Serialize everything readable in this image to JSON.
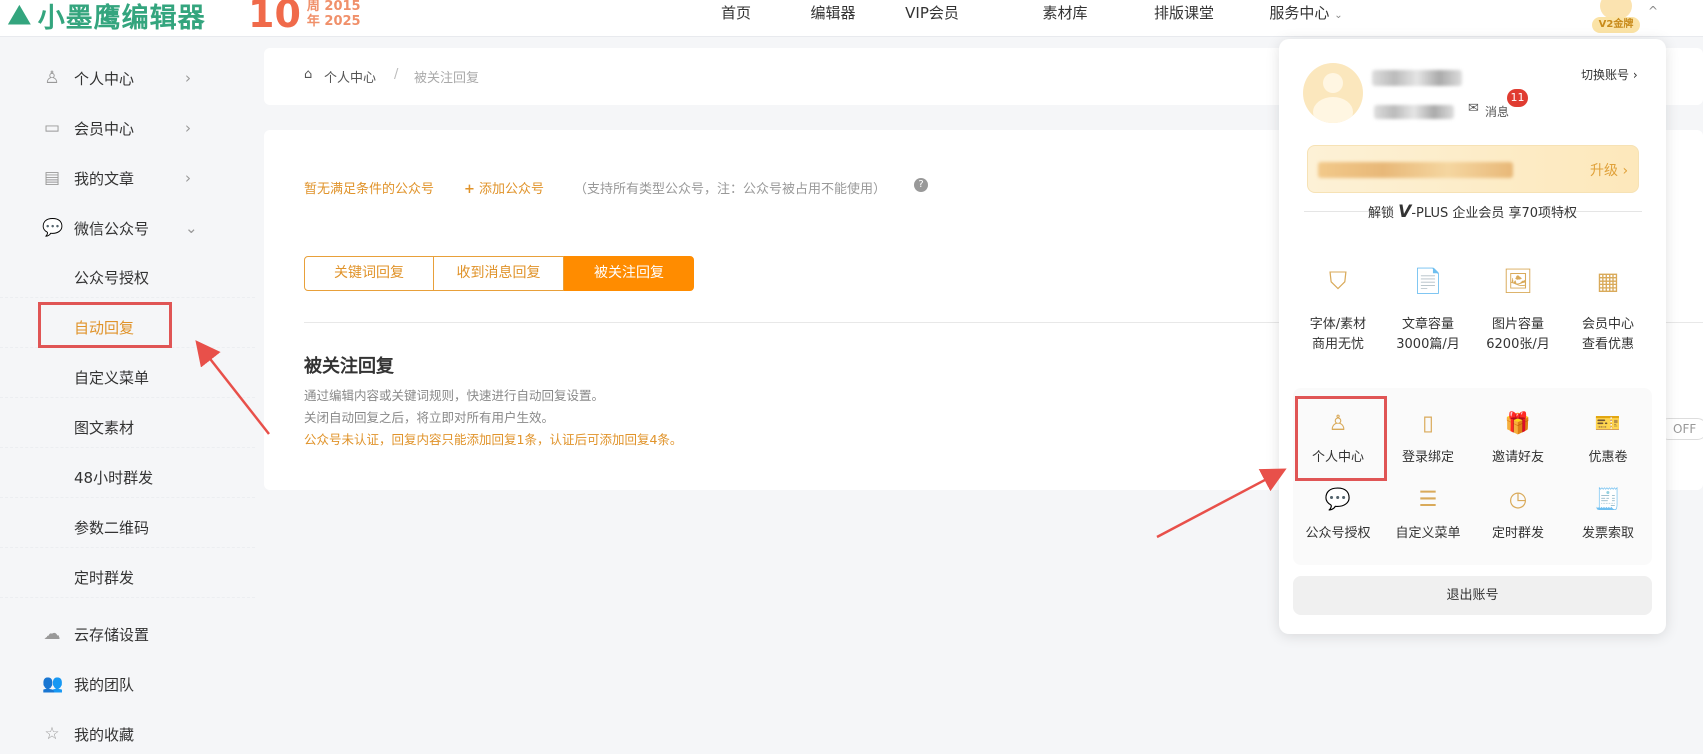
{
  "header": {
    "logo_text": "小墨鹰编辑器",
    "anniv_big": "10",
    "anniv_l1": "周 2015",
    "anniv_l2": "年 2025",
    "nav": [
      "首页",
      "编辑器",
      "VIP会员",
      "素材库",
      "排版课堂",
      "服务中心"
    ],
    "badge": "V2金牌"
  },
  "sidebar": {
    "items": [
      {
        "label": "个人中心",
        "icon": "user-icon",
        "chevron": ">"
      },
      {
        "label": "会员中心",
        "icon": "card-icon",
        "chevron": ">"
      },
      {
        "label": "我的文章",
        "icon": "document-icon",
        "chevron": ">"
      },
      {
        "label": "微信公众号",
        "icon": "chat-icon",
        "chevron": "v"
      },
      {
        "label": "公众号授权"
      },
      {
        "label": "自动回复",
        "active": true
      },
      {
        "label": "自定义菜单"
      },
      {
        "label": "图文素材"
      },
      {
        "label": "48小时群发"
      },
      {
        "label": "参数二维码"
      },
      {
        "label": "定时群发"
      },
      {
        "label": "云存储设置",
        "icon": "cloud-icon"
      },
      {
        "label": "我的团队",
        "icon": "team-icon"
      },
      {
        "label": "我的收藏",
        "icon": "star-icon"
      }
    ]
  },
  "breadcrumb": {
    "home": "个人中心",
    "sep": "/",
    "current": "被关注回复"
  },
  "main": {
    "no_account": "暂无满足条件的公众号",
    "add_account": "添加公众号",
    "note": "（支持所有类型公众号，注：公众号被占用不能使用）",
    "tabs": [
      "关键词回复",
      "收到消息回复",
      "被关注回复"
    ],
    "active_tab": 2,
    "title": "被关注回复",
    "desc1": "通过编辑内容或关键词规则，快速进行自动回复设置。",
    "desc2": "关闭自动回复之后，将立即对所有用户生效。",
    "warn": "公众号未认证，回复内容只能添加回复1条，认证后可添加回复4条。",
    "toggle": "OFF"
  },
  "dropdown": {
    "switch": "切换账号 ›",
    "msg": "消息",
    "msg_count": "11",
    "upgrade": "升级 ›",
    "unlock_pre": "解锁",
    "unlock_v": "V",
    "unlock_post": "-PLUS 企业会员 享70项特权",
    "features": [
      {
        "l1": "字体/素材",
        "l2": "商用无忧",
        "icon": "shield-icon"
      },
      {
        "l1": "文章容量",
        "l2": "3000篇/月",
        "icon": "doc-icon"
      },
      {
        "l1": "图片容量",
        "l2": "6200张/月",
        "icon": "image-icon"
      },
      {
        "l1": "会员中心",
        "l2": "查看优惠",
        "icon": "grid-icon"
      }
    ],
    "quick": [
      {
        "label": "个人中心",
        "icon": "user-icon"
      },
      {
        "label": "登录绑定",
        "icon": "phone-icon"
      },
      {
        "label": "邀请好友",
        "icon": "gift-icon"
      },
      {
        "label": "优惠卷",
        "icon": "coupon-icon"
      },
      {
        "label": "公众号授权",
        "icon": "chat-icon"
      },
      {
        "label": "自定义菜单",
        "icon": "list-icon"
      },
      {
        "label": "定时群发",
        "icon": "clock-icon"
      },
      {
        "label": "发票索取",
        "icon": "invoice-icon"
      }
    ],
    "logout": "退出账号"
  },
  "colors": {
    "accent": "#ff8c00",
    "gold": "#d9aa5a",
    "brand": "#34a57e",
    "annotation": "#e05555"
  }
}
